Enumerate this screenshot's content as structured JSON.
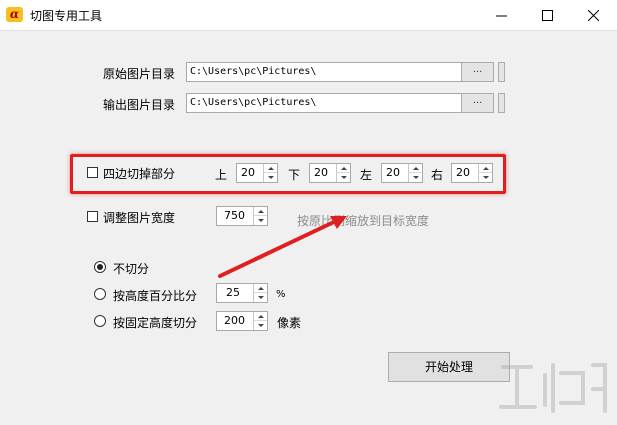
{
  "window": {
    "title": "切图专用工具",
    "icon_name": "app-logo-icon",
    "icon_glyph": "α",
    "accent": "#e02020"
  },
  "folders": {
    "source_label": "原始图片目录",
    "source_path": "C:\\Users\\pc\\Pictures\\",
    "output_label": "输出图片目录",
    "output_path": "C:\\Users\\pc\\Pictures\\",
    "browse_label": "..."
  },
  "crop": {
    "checkbox_label": "四边切掉部分",
    "checked": false,
    "top_label": "上",
    "top_value": "20",
    "bottom_label": "下",
    "bottom_value": "20",
    "left_label": "左",
    "left_value": "20",
    "right_label": "右",
    "right_value": "20"
  },
  "resize": {
    "checkbox_label": "调整图片宽度",
    "checked": false,
    "width_value": "750",
    "hint": "按原比例缩放到目标宽度"
  },
  "split": {
    "options": [
      {
        "label": "不切分",
        "selected": true
      },
      {
        "label": "按高度百分比分",
        "selected": false,
        "value": "25",
        "unit": "%"
      },
      {
        "label": "按固定高度切分",
        "selected": false,
        "value": "200",
        "unit": "像素"
      }
    ]
  },
  "actions": {
    "start_label": "开始处理"
  },
  "annotation": {
    "arrow_color": "#e02020"
  }
}
